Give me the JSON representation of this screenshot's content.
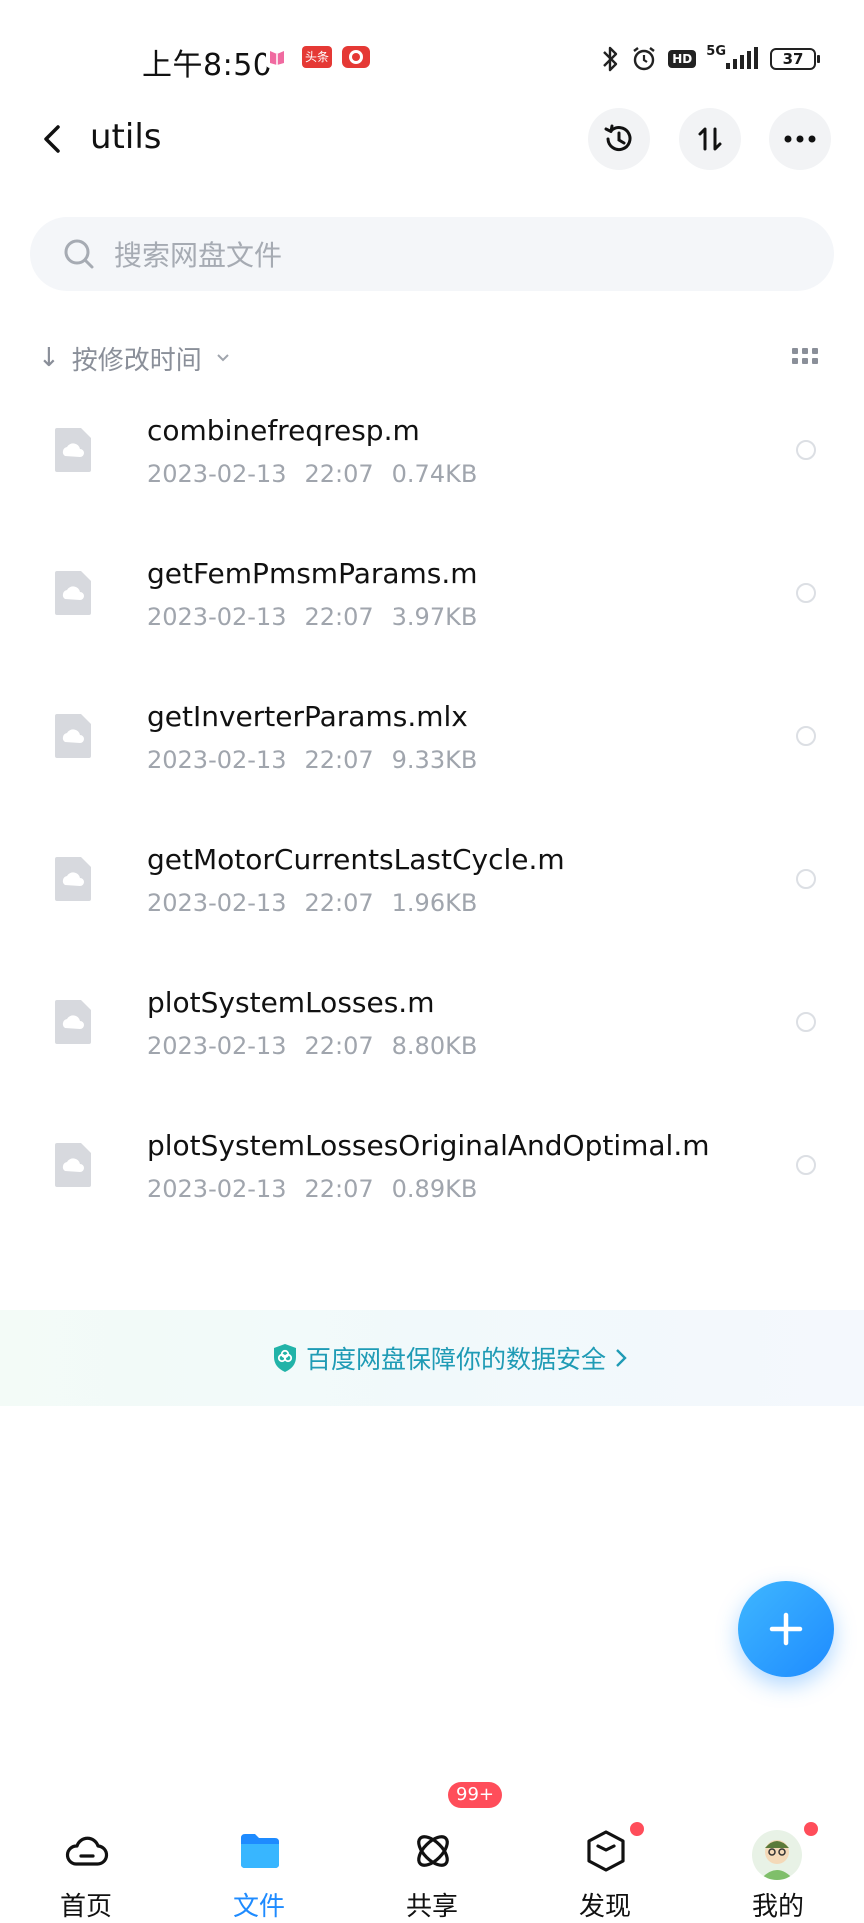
{
  "status_bar": {
    "time": "上午8:50",
    "network": "5G",
    "hd": "HD",
    "battery": "37",
    "notif_apps": [
      "baidu-read",
      "toutiao",
      "pinduoduo"
    ]
  },
  "header": {
    "title": "utils",
    "actions": [
      "history-icon",
      "sort-icon",
      "more-icon"
    ]
  },
  "search": {
    "placeholder": "搜索网盘文件"
  },
  "sort": {
    "label": "按修改时间"
  },
  "files": [
    {
      "name": "combinefreqresp.m",
      "date": "2023-02-13",
      "time": "22:07",
      "size": "0.74KB"
    },
    {
      "name": "getFemPmsmParams.m",
      "date": "2023-02-13",
      "time": "22:07",
      "size": "3.97KB"
    },
    {
      "name": "getInverterParams.mlx",
      "date": "2023-02-13",
      "time": "22:07",
      "size": "9.33KB"
    },
    {
      "name": "getMotorCurrentsLastCycle.m",
      "date": "2023-02-13",
      "time": "22:07",
      "size": "1.96KB"
    },
    {
      "name": "plotSystemLosses.m",
      "date": "2023-02-13",
      "time": "22:07",
      "size": "8.80KB"
    },
    {
      "name": "plotSystemLossesOriginalAndOptimal.m",
      "date": "2023-02-13",
      "time": "22:07",
      "size": "0.89KB"
    }
  ],
  "banner": {
    "text": "百度网盘保障你的数据安全"
  },
  "nav": {
    "items": [
      {
        "label": "首页",
        "icon": "home-cloud-icon"
      },
      {
        "label": "文件",
        "icon": "folder-icon",
        "active": true
      },
      {
        "label": "共享",
        "icon": "share-atom-icon",
        "badge": "99+"
      },
      {
        "label": "发现",
        "icon": "discover-cube-icon",
        "dot": true
      },
      {
        "label": "我的",
        "icon": "avatar",
        "dot": true
      }
    ]
  },
  "colors": {
    "accent": "#1e8bff",
    "banner_text": "#1f9bb5",
    "meta_text": "#a0a5ad",
    "badge": "#ff4d5a"
  }
}
